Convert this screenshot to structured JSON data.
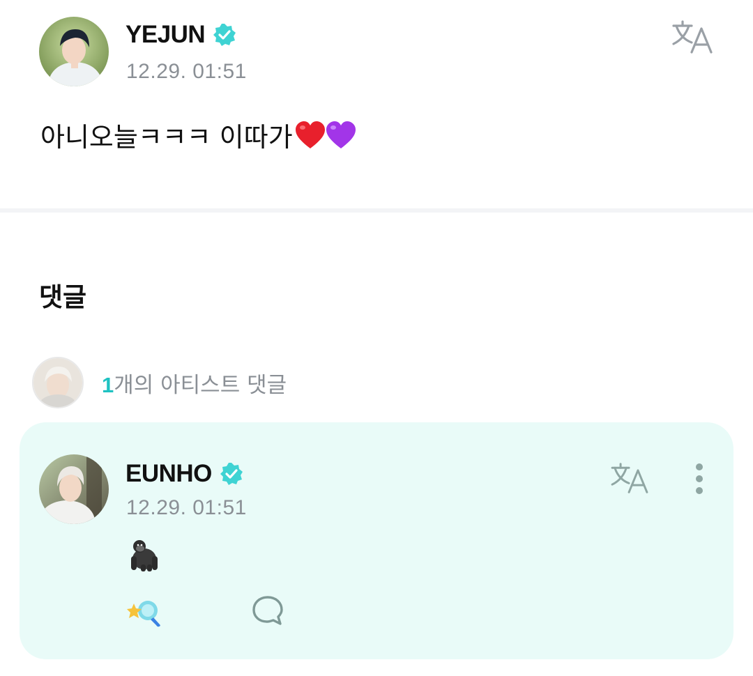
{
  "post": {
    "author": "YEJUN",
    "timestamp": "12.29. 01:51",
    "text": "아니오늘ㅋㅋㅋ 이따가",
    "translate_icon": "translate-icon",
    "emojis": [
      "red-heart",
      "purple-heart"
    ]
  },
  "comments_section": {
    "title": "댓글",
    "artist_count_number": "1",
    "artist_count_suffix": "개의 아티스트 댓글"
  },
  "comment": {
    "author": "EUNHO",
    "timestamp": "12.29. 01:51",
    "content_emoji": "gorilla",
    "actions": [
      "star-wand-icon",
      "speech-bubble-icon"
    ],
    "menu_icon": "more-vertical-icon"
  },
  "colors": {
    "verified": "#3fd3d3",
    "accent": "#1fc2c2",
    "comment_bg": "#e9fbf8",
    "muted_text": "#8a8f95"
  }
}
